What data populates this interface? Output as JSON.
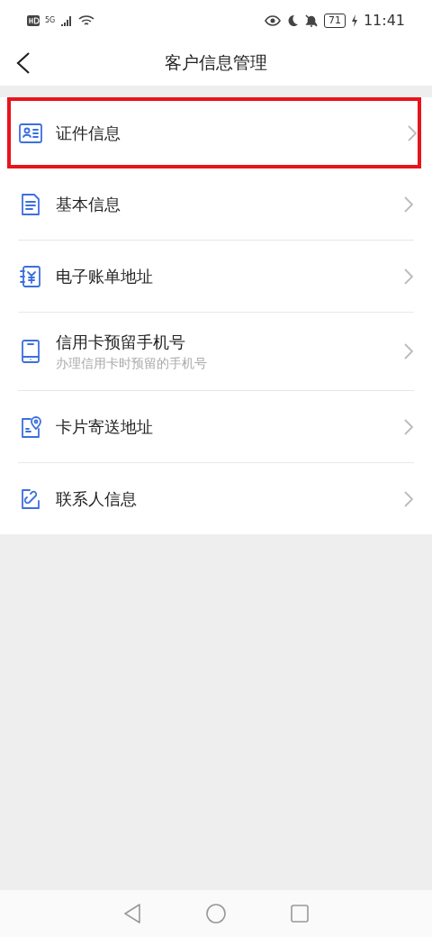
{
  "status_bar": {
    "network": "5G",
    "battery": "71",
    "time": "11:41"
  },
  "header": {
    "title": "客户信息管理"
  },
  "items": [
    {
      "kind": "id-card",
      "label": "证件信息",
      "highlighted": true
    },
    {
      "kind": "document",
      "label": "基本信息",
      "highlighted": false
    },
    {
      "kind": "bill",
      "label": "电子账单地址",
      "highlighted": false
    },
    {
      "kind": "phone",
      "label": "信用卡预留手机号",
      "subtitle": "办理信用卡时预留的手机号",
      "highlighted": false
    },
    {
      "kind": "location",
      "label": "卡片寄送地址",
      "highlighted": false
    },
    {
      "kind": "link",
      "label": "联系人信息",
      "highlighted": false
    }
  ]
}
